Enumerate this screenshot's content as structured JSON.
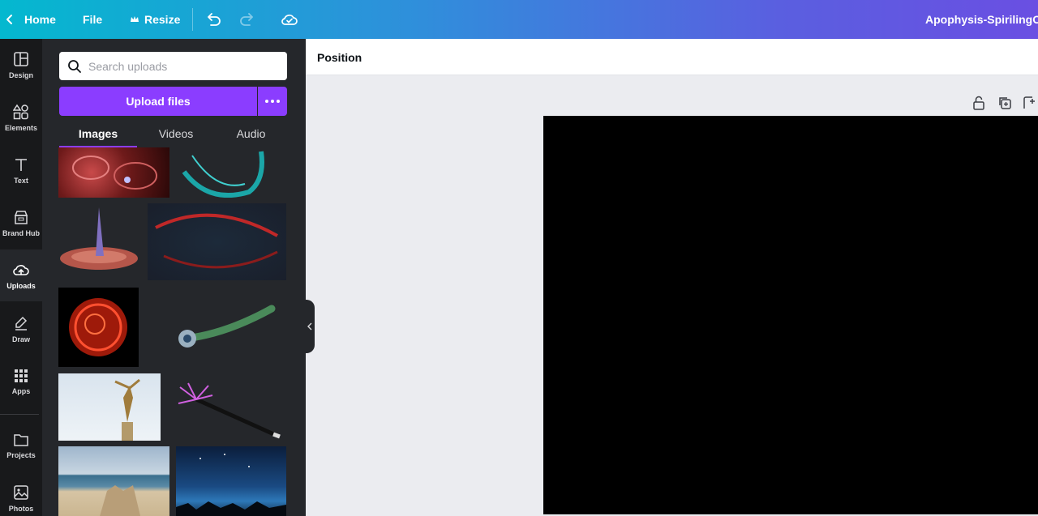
{
  "topbar": {
    "home_label": "Home",
    "file_label": "File",
    "resize_label": "Resize",
    "design_title": "Apophysis-SpirilingOut",
    "gradient": [
      "#04b8cf",
      "#6a4fe2"
    ]
  },
  "rail": {
    "items": [
      {
        "label": "Design",
        "icon": "layout-icon"
      },
      {
        "label": "Elements",
        "icon": "shapes-icon"
      },
      {
        "label": "Text",
        "icon": "text-icon"
      },
      {
        "label": "Brand Hub",
        "icon": "brand-icon"
      },
      {
        "label": "Uploads",
        "icon": "cloud-upload-icon",
        "active": true
      },
      {
        "label": "Draw",
        "icon": "pen-icon"
      },
      {
        "label": "Apps",
        "icon": "grid-icon"
      },
      {
        "label": "Projects",
        "icon": "folder-icon"
      },
      {
        "label": "Photos",
        "icon": "image-icon"
      }
    ]
  },
  "panel": {
    "search_placeholder": "Search uploads",
    "upload_label": "Upload files",
    "tabs": [
      {
        "label": "Images",
        "active": true
      },
      {
        "label": "Videos"
      },
      {
        "label": "Audio"
      }
    ],
    "accent": "#8b3dff"
  },
  "context": {
    "position_label": "Position"
  }
}
